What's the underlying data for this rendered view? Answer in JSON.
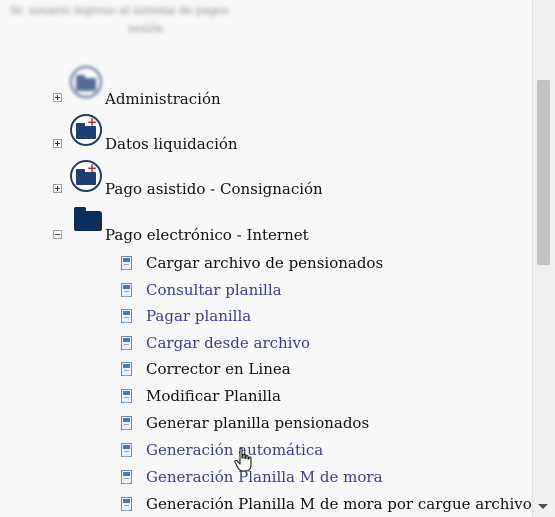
{
  "header": {
    "line1": "Sr. usuario ingreso al sistema de pagos",
    "line2": "sesión",
    "line3": ""
  },
  "tree": {
    "nodes": [
      {
        "label": "Administración",
        "expanded": false,
        "icon": "folder-plus-icon"
      },
      {
        "label": "Datos liquidación",
        "expanded": false,
        "icon": "folder-plus-icon"
      },
      {
        "label": "Pago asistido - Consignación",
        "expanded": false,
        "icon": "folder-plus-icon"
      },
      {
        "label": "Pago electrónico - Internet",
        "expanded": true,
        "icon": "folder-icon"
      }
    ],
    "children": [
      {
        "label": "Cargar archivo de pensionados",
        "style": "plain"
      },
      {
        "label": "Consultar planilla",
        "style": "link"
      },
      {
        "label": "Pagar planilla",
        "style": "link"
      },
      {
        "label": "Cargar desde archivo",
        "style": "link"
      },
      {
        "label": "Corrector en Linea",
        "style": "plain"
      },
      {
        "label": "Modificar Planilla",
        "style": "plain"
      },
      {
        "label": "Generar planilla pensionados",
        "style": "plain"
      },
      {
        "label": "Generación automática",
        "style": "link"
      },
      {
        "label": "Generación Planilla M de mora",
        "style": "link"
      },
      {
        "label": "Generación Planilla M de mora por cargue archivo",
        "style": "plain"
      }
    ]
  },
  "colors": {
    "link": "#3c3c96",
    "text": "#111111",
    "folder": "#1d3f73",
    "folder_plus": "#d32020"
  }
}
